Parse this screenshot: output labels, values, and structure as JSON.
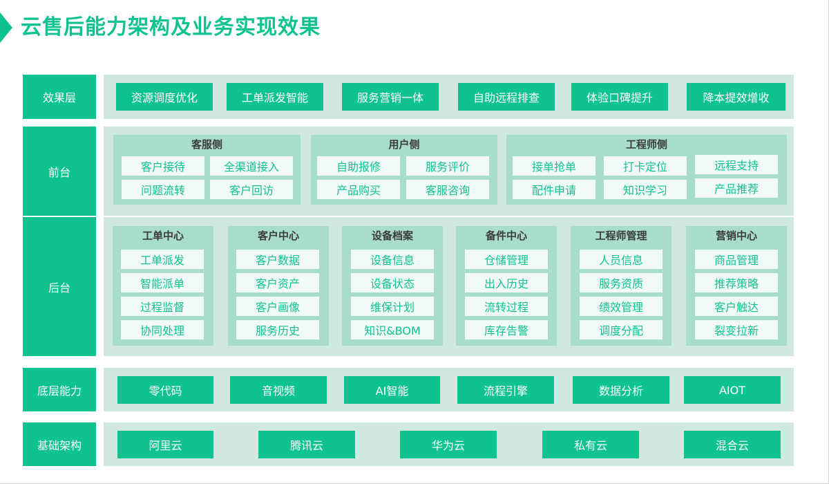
{
  "title": "云售后能力架构及业务实现效果",
  "layers": {
    "effect": "效果层",
    "front": "前台",
    "back": "后台",
    "base_ability": "底层能力",
    "infra": "基础架构"
  },
  "effect_items": [
    "资源调度优化",
    "工单派发智能",
    "服务营销一体",
    "自助远程排查",
    "体验口碑提升",
    "降本提效增收"
  ],
  "front_groups": [
    {
      "title": "客服侧",
      "items": [
        "客户接待",
        "全渠道接入",
        "问题流转",
        "客户回访"
      ]
    },
    {
      "title": "用户侧",
      "items": [
        "自助报修",
        "服务评价",
        "产品购买",
        "客服咨询"
      ]
    },
    {
      "title": "工程师侧",
      "items": [
        "接单抢单",
        "打卡定位",
        "远程支持",
        "配件申请",
        "知识学习",
        "产品推荐"
      ]
    }
  ],
  "back_groups": [
    {
      "title": "工单中心",
      "items": [
        "工单派发",
        "智能派单",
        "过程监督",
        "协同处理"
      ]
    },
    {
      "title": "客户中心",
      "items": [
        "客户数据",
        "客户资产",
        "客户画像",
        "服务历史"
      ]
    },
    {
      "title": "设备档案",
      "items": [
        "设备信息",
        "设备状态",
        "维保计划",
        "知识&BOM"
      ]
    },
    {
      "title": "备件中心",
      "items": [
        "仓储管理",
        "出入历史",
        "流转过程",
        "库存告警"
      ]
    },
    {
      "title": "工程师管理",
      "items": [
        "人员信息",
        "服务资质",
        "绩效管理",
        "调度分配"
      ]
    },
    {
      "title": "营销中心",
      "items": [
        "商品管理",
        "推荐策略",
        "客户触达",
        "裂变拉新"
      ]
    }
  ],
  "base_items": [
    "零代码",
    "音视频",
    "AI智能",
    "流程引擎",
    "数据分析",
    "AIOT"
  ],
  "infra_items": [
    "阿里云",
    "腾讯云",
    "华为云",
    "私有云",
    "混合云"
  ],
  "colors": {
    "accent": "#0ec38f",
    "band": "#cfe8e0",
    "panel": "#a8dccb",
    "box": "#f1faf7"
  }
}
